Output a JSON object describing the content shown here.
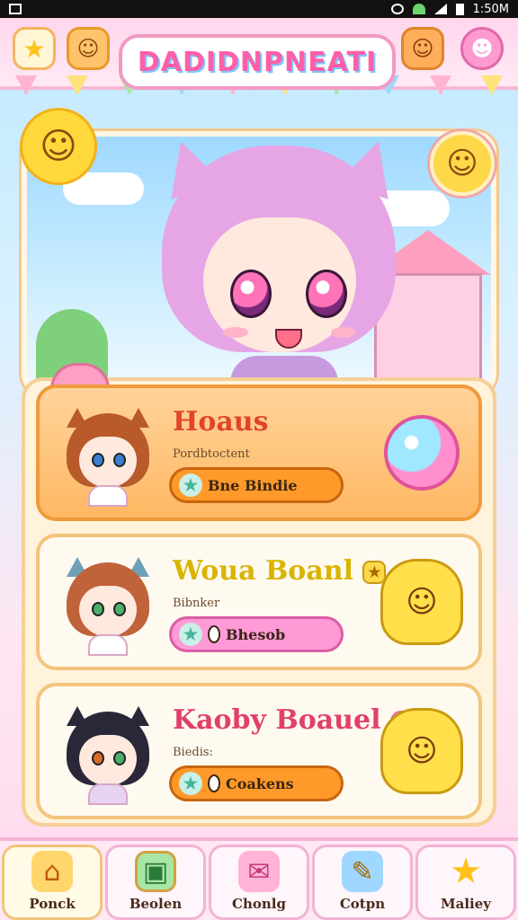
{
  "status_bar": {
    "time": "1:50M"
  },
  "header": {
    "game_title": "DADIDNPNEATI",
    "icons": [
      "star-icon",
      "smiley-face-icon",
      "bear-face-icon",
      "pink-face-icon"
    ]
  },
  "hero": {
    "badge_icon": "smiley-face-icon"
  },
  "cards": [
    {
      "title": "Hoaus",
      "subtitle": "Pordbtoctent",
      "pill_label": "Bne Bindie",
      "title_color": "#e0452b",
      "deco_icon": "bubble-icon",
      "active": true
    },
    {
      "title": "Woua Boanl",
      "subtitle": "Bibnker",
      "pill_label": "Bhesob",
      "title_color": "#d9b400",
      "deco_icon": "yellow-dog-icon",
      "active": false
    },
    {
      "title": "Kaoby Boauel",
      "subtitle": "Biedis:",
      "pill_label": "Coakens",
      "title_color": "#e0406a",
      "deco_icon": "yellow-cat-icon",
      "active": false
    }
  ],
  "bottom_nav": [
    {
      "label": "Ponck",
      "icon": "house-icon"
    },
    {
      "label": "Beolen",
      "icon": "picture-frame-icon"
    },
    {
      "label": "Chonlg",
      "icon": "envelope-icon"
    },
    {
      "label": "Cotpn",
      "icon": "notebook-icon"
    },
    {
      "label": "Maliey",
      "icon": "star-icon"
    }
  ]
}
